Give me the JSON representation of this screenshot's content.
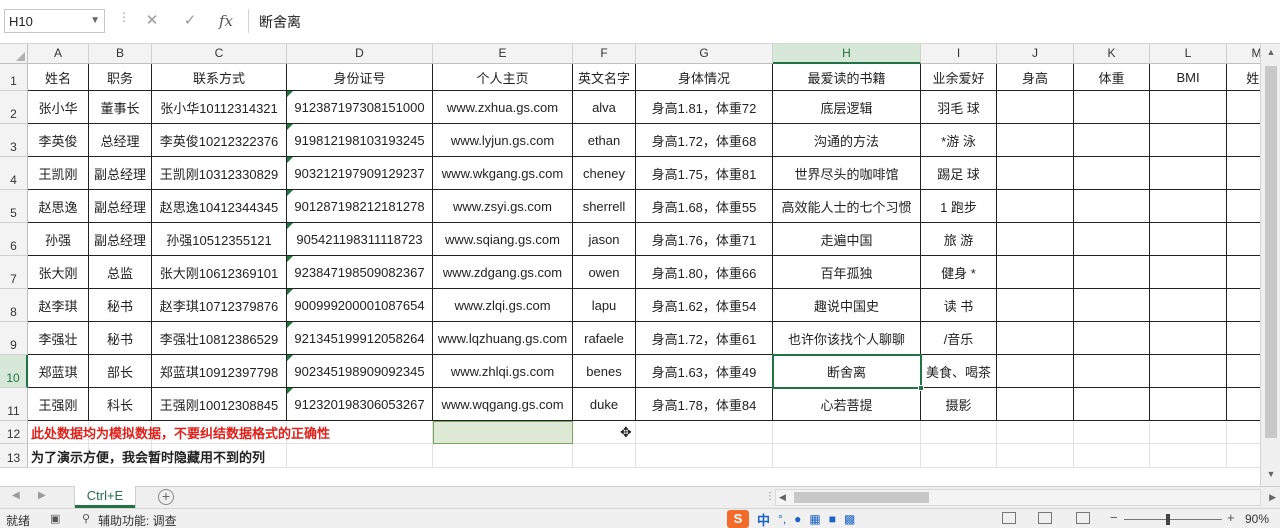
{
  "formula_bar": {
    "name_box": "H10",
    "cancel_icon": "close-icon",
    "confirm_icon": "check-icon",
    "fx_label": "fx",
    "content": "断舍离"
  },
  "columns": [
    "A",
    "B",
    "C",
    "D",
    "E",
    "F",
    "G",
    "H",
    "I",
    "J",
    "K",
    "L",
    "M"
  ],
  "selected_column": "H",
  "selected_row": 10,
  "active_cell": "H10",
  "rows": [
    "1",
    "2",
    "3",
    "4",
    "5",
    "6",
    "7",
    "8",
    "9",
    "10",
    "11",
    "12",
    "13"
  ],
  "header_row": [
    "姓名",
    "职务",
    "联系方式",
    "身份证号",
    "个人主页",
    "英文名字",
    "身体情况",
    "最爱读的书籍",
    "业余爱好",
    "身高",
    "体重",
    "BMI",
    "姓+"
  ],
  "table": [
    [
      "张小华",
      "董事长",
      "张小华10112314321",
      "912387197308151000",
      "www.zxhua.gs.com",
      "alva",
      "身高1.81，体重72",
      "底层逻辑",
      "羽毛  球"
    ],
    [
      "李英俊",
      "总经理",
      "李英俊10212322376",
      "919812198103193245",
      "www.lyjun.gs.com",
      "ethan",
      "身高1.72，体重68",
      "沟通的方法",
      "*游 泳"
    ],
    [
      "王凯刚",
      "副总经理",
      "王凯刚10312330829",
      "903212197909129237",
      "www.wkgang.gs.com",
      "cheney",
      "身高1.75，体重81",
      "世界尽头的咖啡馆",
      "踢足  球"
    ],
    [
      "赵思逸",
      "副总经理",
      "赵思逸10412344345",
      "901287198212181278",
      "www.zsyi.gs.com",
      "sherrell",
      "身高1.68，体重55",
      "高效能人士的七个习惯",
      "1 跑步"
    ],
    [
      "孙强",
      "副总经理",
      "孙强10512355121",
      "905421198311118723",
      "www.sqiang.gs.com",
      "jason",
      "身高1.76，体重71",
      "走遍中国",
      "旅   游"
    ],
    [
      "张大刚",
      "总监",
      "张大刚10612369101",
      "923847198509082367",
      "www.zdgang.gs.com",
      "owen",
      "身高1.80，体重66",
      "百年孤独",
      "健身 *"
    ],
    [
      "赵李琪",
      "秘书",
      "赵李琪10712379876",
      "900999200001087654",
      "www.zlqi.gs.com",
      "lapu",
      "身高1.62，体重54",
      "趣说中国史",
      "读 书"
    ],
    [
      "李强壮",
      "秘书",
      "李强壮10812386529",
      "921345199912058264",
      "www.lqzhuang.gs.com",
      "rafaele",
      "身高1.72，体重61",
      "也许你该找个人聊聊",
      "/音乐"
    ],
    [
      "郑蓝琪",
      "部长",
      "郑蓝琪10912397798",
      "902345198909092345",
      "www.zhlqi.gs.com",
      "benes",
      "身高1.63，体重49",
      "断舍离",
      "美食、喝茶"
    ],
    [
      "王强刚",
      "科长",
      "王强刚10012308845",
      "912320198306053267",
      "www.wqgang.gs.com",
      "duke",
      "身高1.78，体重84",
      "心若菩提",
      "摄影"
    ]
  ],
  "notes": {
    "row12": "此处数据均为模拟数据，不要纠结数据格式的正确性",
    "row13": "为了演示方便，我会暂时隐藏用不到的列"
  },
  "sheet_tabs": [
    {
      "label": "Ctrl+E",
      "active": true
    }
  ],
  "add_sheet_label": "+",
  "status_bar": {
    "ready": "就绪",
    "accessibility": "辅助功能: 调查",
    "ime_logo": "S",
    "ime_mode": "中",
    "zoom": "90%"
  },
  "colors": {
    "accent": "#217346",
    "note_red": "#e0201a",
    "selection_fill": "#dde9d4"
  }
}
